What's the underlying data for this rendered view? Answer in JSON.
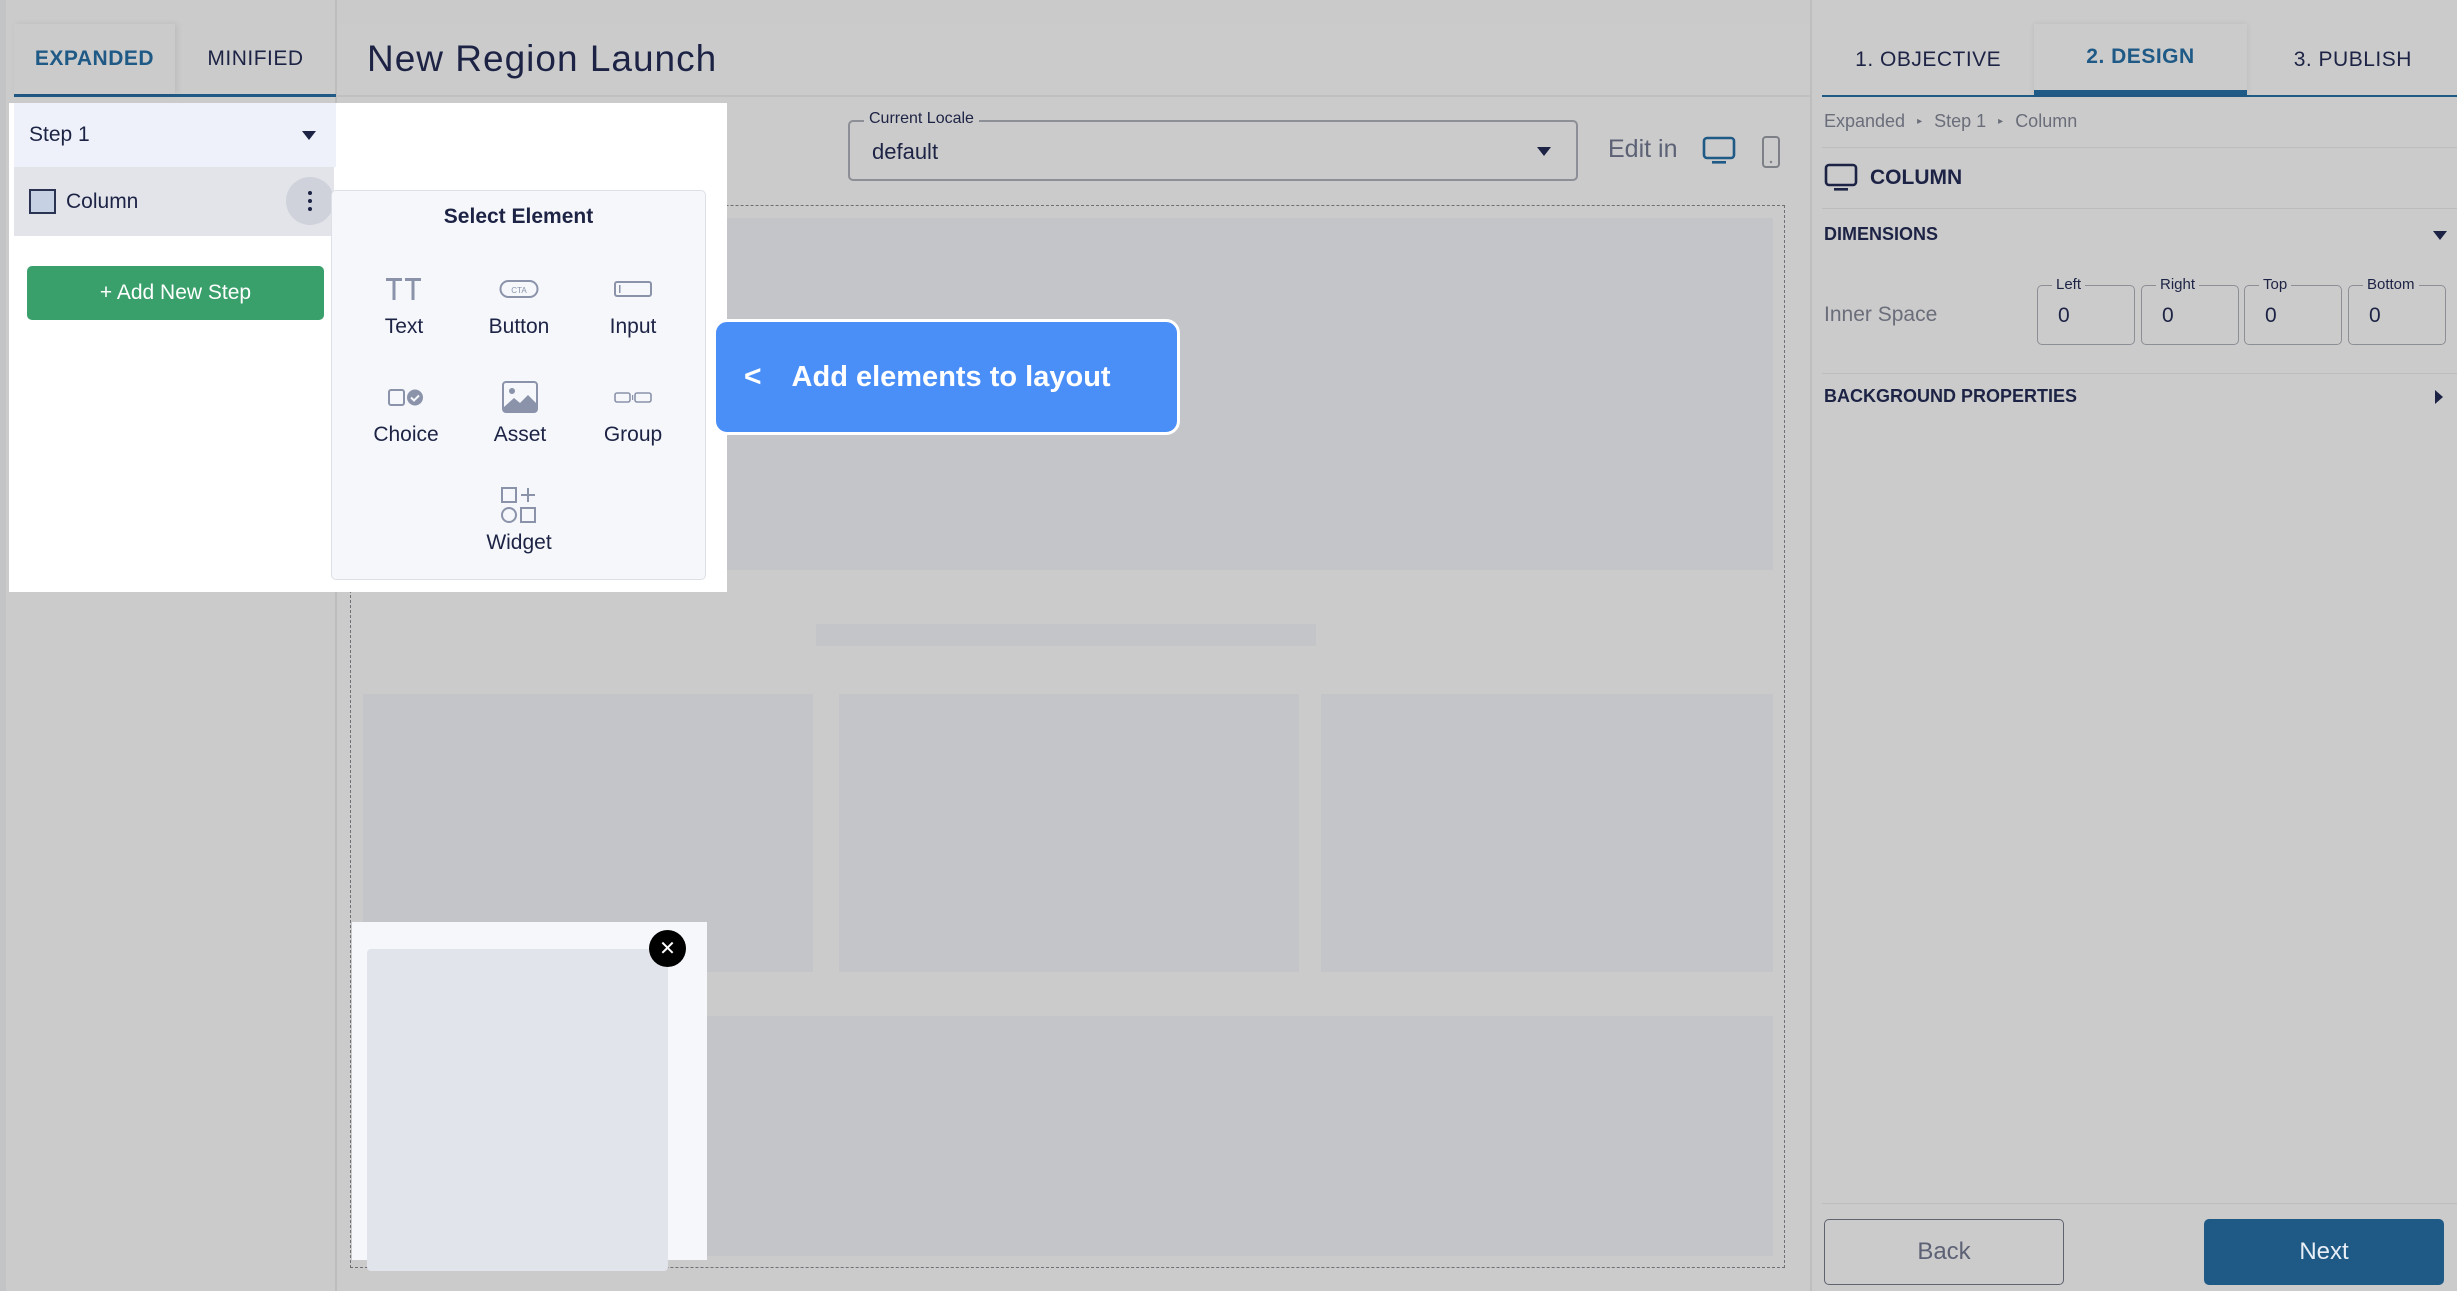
{
  "left_tabs": [
    {
      "label": "EXPANDED",
      "active": true
    },
    {
      "label": "MINIFIED",
      "active": false
    }
  ],
  "page_title": "New Region Launch",
  "step_select": {
    "value": "Step 1"
  },
  "layers": [
    {
      "label": "Column"
    }
  ],
  "add_step_label": "+ Add New Step",
  "select_element": {
    "title": "Select Element",
    "items": [
      {
        "label": "Text",
        "icon": "text-icon"
      },
      {
        "label": "Button",
        "icon": "button-cta-icon"
      },
      {
        "label": "Input",
        "icon": "input-icon"
      },
      {
        "label": "Choice",
        "icon": "choice-icon"
      },
      {
        "label": "Asset",
        "icon": "image-icon"
      },
      {
        "label": "Group",
        "icon": "group-icon"
      },
      {
        "label": "Widget",
        "icon": "widget-icon"
      }
    ],
    "button_icon_text": "CTA"
  },
  "tooltip": {
    "chevron": "<",
    "text": "Add elements to layout"
  },
  "locale": {
    "legend": "Current Locale",
    "value": "default"
  },
  "edit_in_label": "Edit in",
  "mini_popup": {
    "close_glyph": "✕"
  },
  "right_tabs": [
    {
      "label": "1. OBJECTIVE",
      "active": false
    },
    {
      "label": "2. DESIGN",
      "active": true
    },
    {
      "label": "3. PUBLISH",
      "active": false
    }
  ],
  "breadcrumb": [
    "Expanded",
    "Step 1",
    "Column"
  ],
  "breadcrumb_sep": "▸",
  "element_heading": "COLUMN",
  "sections": {
    "dimensions": "DIMENSIONS",
    "background": "BACKGROUND PROPERTIES"
  },
  "inner_space": {
    "label": "Inner Space",
    "fields": [
      {
        "legend": "Left",
        "value": "0"
      },
      {
        "legend": "Right",
        "value": "0"
      },
      {
        "legend": "Top",
        "value": "0"
      },
      {
        "legend": "Bottom",
        "value": "0"
      }
    ]
  },
  "footer": {
    "back": "Back",
    "next": "Next"
  },
  "colors": {
    "accent": "#1f5a86",
    "add_step_green": "#3aa06b",
    "tooltip_blue": "#4a8ef7"
  }
}
